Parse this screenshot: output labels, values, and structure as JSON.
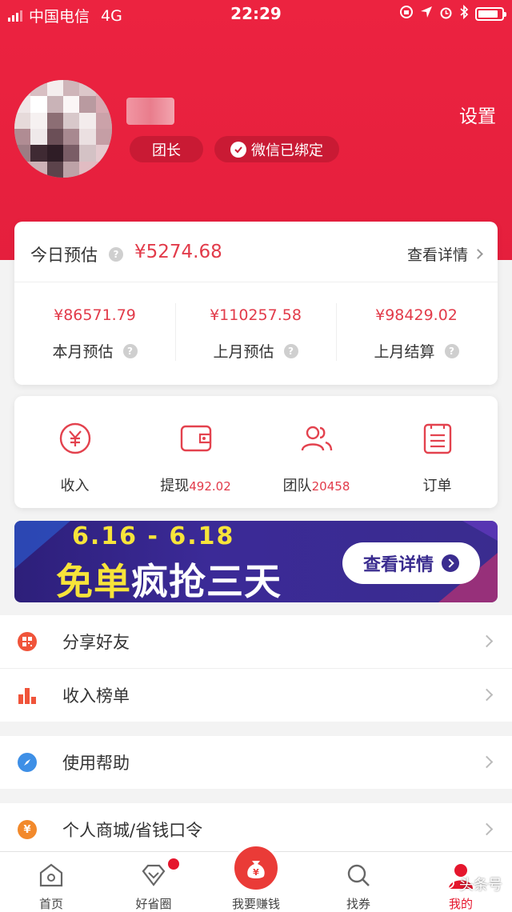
{
  "status_bar": {
    "carrier": "中国电信",
    "network": "4G",
    "time": "22:29"
  },
  "profile": {
    "role_badge": "团长",
    "wechat_badge": "微信已绑定",
    "settings_label": "设置"
  },
  "earnings": {
    "today_label": "今日预估",
    "today_value": "¥5274.68",
    "detail_link": "查看详情",
    "stats": [
      {
        "value": "¥86571.79",
        "label": "本月预估"
      },
      {
        "value": "¥110257.58",
        "label": "上月预估"
      },
      {
        "value": "¥98429.02",
        "label": "上月结算"
      }
    ]
  },
  "quick_menu": [
    {
      "label": "收入",
      "icon": "yuan-coin-icon"
    },
    {
      "label": "提现",
      "value": "492.02",
      "icon": "wallet-icon"
    },
    {
      "label": "团队",
      "value": "20458",
      "icon": "team-icon"
    },
    {
      "label": "订单",
      "icon": "order-list-icon"
    }
  ],
  "banner": {
    "date": "6.16 - 6.18",
    "headline_yellow": "免单",
    "headline_white": "疯抢三天",
    "button_label": "查看详情"
  },
  "list_rows": [
    {
      "label": "分享好友",
      "icon": "share-qr-icon"
    },
    {
      "label": "收入榜单",
      "icon": "bar-chart-icon"
    },
    {
      "label": "使用帮助",
      "icon": "compass-icon"
    },
    {
      "label": "个人商城/省钱口令",
      "icon": "coin-icon"
    }
  ],
  "tabbar": [
    {
      "label": "首页",
      "icon": "home-icon"
    },
    {
      "label": "好省圈",
      "icon": "diamond-icon"
    },
    {
      "label": "我要赚钱",
      "icon": "money-bag-icon"
    },
    {
      "label": "找券",
      "icon": "search-icon"
    },
    {
      "label": "我的",
      "icon": "user-icon",
      "active": true
    }
  ],
  "watermark": "头条号",
  "colors": {
    "header_red": "#ec2340",
    "price_red": "#e23b4a",
    "banner_purple": "#3a2c8f",
    "banner_yellow": "#f7e43a",
    "tab_active": "#e5162d"
  }
}
